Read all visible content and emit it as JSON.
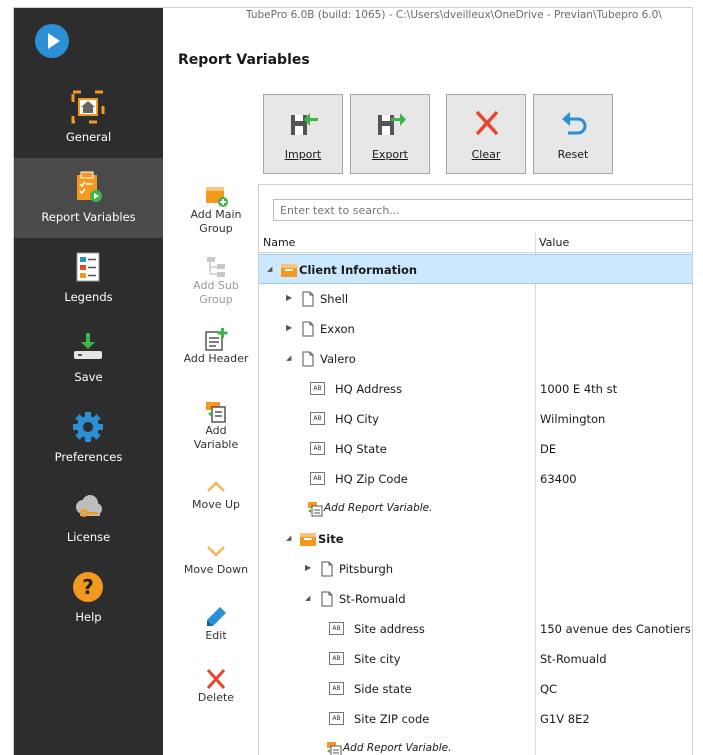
{
  "window": {
    "title": "TubePro 6.0B (build: 1065) - C:\\Users\\dveilleux\\OneDrive - Previan\\Tubepro 6.0\\"
  },
  "sidebar": {
    "items": [
      {
        "label": "General",
        "icon": "house-icon"
      },
      {
        "label": "Report Variables",
        "icon": "report-variables-icon",
        "active": true
      },
      {
        "label": "Legends",
        "icon": "legends-icon"
      },
      {
        "label": "Save",
        "icon": "save-icon"
      },
      {
        "label": "Preferences",
        "icon": "gear-icon"
      },
      {
        "label": "License",
        "icon": "cloud-key-icon"
      },
      {
        "label": "Help",
        "icon": "help-icon"
      }
    ]
  },
  "page": {
    "title": "Report Variables"
  },
  "toolbar": {
    "import": "Import",
    "export": "Export",
    "clear": "Clear",
    "reset": "Reset"
  },
  "actions": {
    "add_main_group": "Add Main Group",
    "add_sub_group": "Add Sub Group",
    "add_header": "Add Header",
    "add_variable": "Add Variable",
    "move_up": "Move Up",
    "move_down": "Move Down",
    "edit": "Edit",
    "delete": "Delete"
  },
  "search": {
    "placeholder": "Enter text to search..."
  },
  "tree": {
    "columns": [
      "Name",
      "Value"
    ],
    "rows": [
      {
        "label": "Client Information",
        "value": "",
        "type": "group",
        "level": 0,
        "expanded": true,
        "selected": true
      },
      {
        "label": "Shell",
        "value": "",
        "type": "header",
        "level": 1,
        "expanded": false
      },
      {
        "label": "Exxon",
        "value": "",
        "type": "header",
        "level": 1,
        "expanded": false
      },
      {
        "label": "Valero",
        "value": "",
        "type": "header",
        "level": 1,
        "expanded": true
      },
      {
        "label": "HQ Address",
        "value": "1000 E 4th st",
        "type": "variable",
        "level": 2
      },
      {
        "label": "HQ City",
        "value": "Wilmington",
        "type": "variable",
        "level": 2
      },
      {
        "label": "HQ State",
        "value": "DE",
        "type": "variable",
        "level": 2
      },
      {
        "label": "HQ Zip Code",
        "value": "63400",
        "type": "variable",
        "level": 2
      },
      {
        "label": "Add Report Variable.",
        "value": "",
        "type": "add",
        "level": 2
      },
      {
        "label": "Site",
        "value": "",
        "type": "group",
        "level": 1,
        "expanded": true
      },
      {
        "label": "Pitsburgh",
        "value": "",
        "type": "header",
        "level": 2,
        "expanded": false
      },
      {
        "label": "St-Romuald",
        "value": "",
        "type": "header",
        "level": 2,
        "expanded": true
      },
      {
        "label": "Site address",
        "value": "150 avenue des Canotiers",
        "type": "variable",
        "level": 3
      },
      {
        "label": "Site city",
        "value": "St-Romuald",
        "type": "variable",
        "level": 3
      },
      {
        "label": "Side state",
        "value": "QC",
        "type": "variable",
        "level": 3
      },
      {
        "label": "Site ZIP code",
        "value": "G1V 8E2",
        "type": "variable",
        "level": 3
      },
      {
        "label": "Add Report Variable.",
        "value": "",
        "type": "add",
        "level": 3
      }
    ]
  },
  "icon_badge": "AB",
  "colors": {
    "sidebar_bg": "#2d2d2d",
    "sidebar_active": "#4a4a4a",
    "accent_blue": "#2b8fd6",
    "orange": "#f39a1e",
    "selection": "#cce8ff",
    "delete_red": "#e8452c"
  }
}
